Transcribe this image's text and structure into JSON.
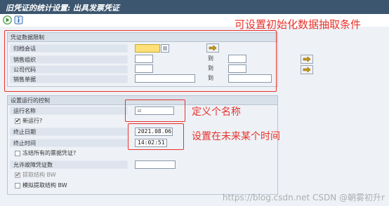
{
  "window": {
    "title": "旧凭证的统计设置: 出具发票凭证"
  },
  "toolbar": {
    "icons": [
      "execute-icon",
      "info-icon"
    ]
  },
  "group1": {
    "title": "凭证数据限制",
    "rows": [
      {
        "label": "归档会话",
        "to": ""
      },
      {
        "label": "销售组织",
        "to": "到"
      },
      {
        "label": "公司代码",
        "to": "到"
      },
      {
        "label": "销售单据",
        "to": "到"
      }
    ]
  },
  "group2": {
    "title": "设置运行的控制",
    "run_name_label": "运行名称",
    "run_name_value": "☑",
    "new_run_label": "新运行?",
    "new_run_checked": "✔",
    "end_date_label": "终止日期",
    "end_date_value": "2021.08.06",
    "end_time_label": "终止时间",
    "end_time_value": "14:02:51",
    "freeze_label": "冻结所有的票据凭证?",
    "allow_error_label": "允许故障凭证数",
    "extract_bw_label": "提取结构 BW",
    "extract_bw_checked": "✔",
    "simulate_bw_label": "模拟提取结构 BW"
  },
  "annotations": {
    "init_conditions": "可设置初始化数据抽取条件",
    "define_name": "定义个名称",
    "future_time": "设置在未来某个时间"
  },
  "watermark": "https://blog.csdn.net CSDN @朝雾初升r",
  "colors": {
    "title_bar": "#3d566f",
    "annotation_red": "#e8322b",
    "input_focus": "#ffdf78"
  }
}
